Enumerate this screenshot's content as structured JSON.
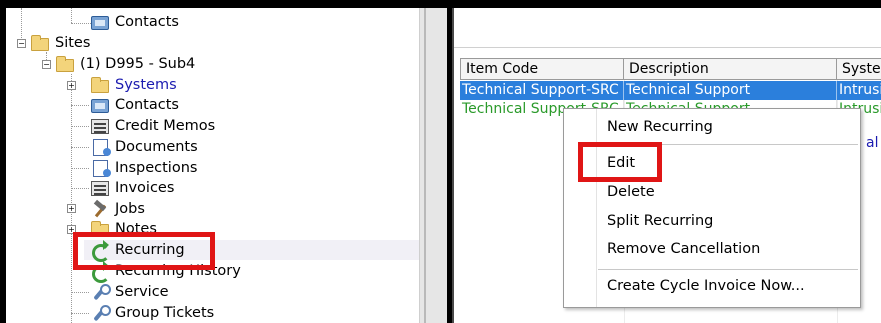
{
  "tree": {
    "items": [
      {
        "label": "Contacts"
      },
      {
        "label": "Sites"
      },
      {
        "label": "(1) D995 - Sub4"
      },
      {
        "label": "Systems"
      },
      {
        "label": "Contacts"
      },
      {
        "label": "Credit Memos"
      },
      {
        "label": "Documents"
      },
      {
        "label": "Inspections"
      },
      {
        "label": "Invoices"
      },
      {
        "label": "Jobs"
      },
      {
        "label": "Notes"
      },
      {
        "label": "Recurring"
      },
      {
        "label": "Recurring History"
      },
      {
        "label": "Service"
      },
      {
        "label": "Group Tickets"
      }
    ],
    "expand_symbols": {
      "expanded": "−",
      "collapsed": "+"
    }
  },
  "grid": {
    "columns": [
      "Item Code",
      "Description",
      "System"
    ],
    "rows": [
      {
        "item_code": "Technical Support-SRC",
        "description": "Technical Support",
        "system": "Intrusion",
        "selected": true
      },
      {
        "item_code": "Technical Support-SRC",
        "description": "Technical Support",
        "system": "Intrusion",
        "selected": false
      }
    ],
    "partial_text": "al"
  },
  "context_menu": {
    "items": [
      {
        "label": "New Recurring"
      },
      {
        "label": "Edit"
      },
      {
        "label": "Delete"
      },
      {
        "label": "Split Recurring"
      },
      {
        "label": "Remove Cancellation"
      },
      {
        "label": "Create Cycle Invoice Now..."
      }
    ]
  },
  "colors": {
    "highlight_box": "#e01515",
    "selection": "#2b7fdc",
    "link_blue": "#1b1bb0",
    "row_green": "#2a9a2a"
  },
  "icons": {
    "folder": "folder-icon",
    "contacts": "contact-card-icon",
    "memo": "memo-icon",
    "document": "document-icon",
    "wrench": "wrench-icon",
    "hammer": "hammer-icon",
    "recurring": "recurring-arrows-icon"
  }
}
